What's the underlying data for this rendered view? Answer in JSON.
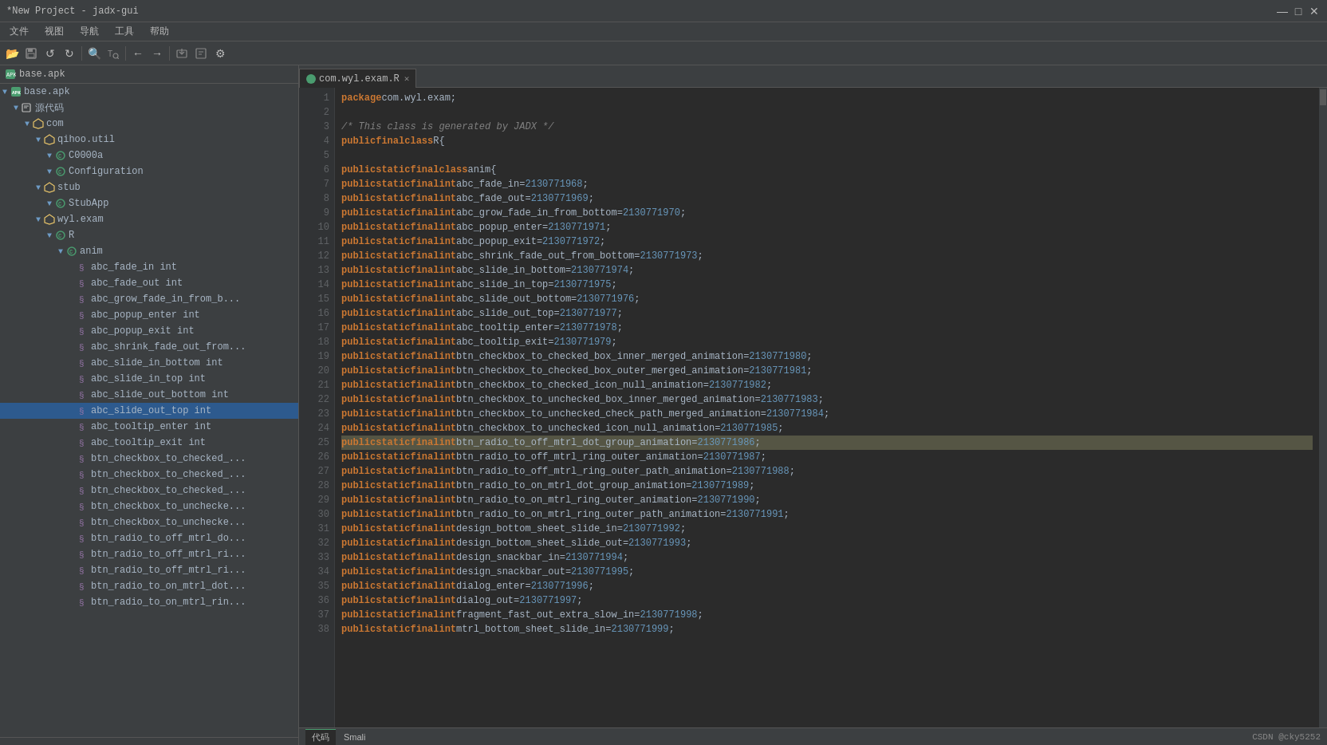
{
  "window": {
    "title": "*New Project - jadx-gui",
    "controls": [
      "—",
      "□",
      "✕"
    ]
  },
  "menu": {
    "items": [
      "文件",
      "视图",
      "导航",
      "工具",
      "帮助"
    ]
  },
  "toolbar": {
    "buttons": [
      "📂",
      "💾",
      "↺",
      "↻",
      "🔍",
      "⚙"
    ]
  },
  "sidebar": {
    "header": "base.apk",
    "tree": [
      {
        "id": 1,
        "indent": 0,
        "arrow": "▼",
        "icon": "📦",
        "label": "base.apk",
        "iconClass": "icon-apk",
        "type": "apk"
      },
      {
        "id": 2,
        "indent": 1,
        "arrow": "▼",
        "icon": "📂",
        "label": "源代码",
        "iconClass": "icon-src",
        "type": "src"
      },
      {
        "id": 3,
        "indent": 2,
        "arrow": "▼",
        "icon": "📦",
        "label": "com",
        "iconClass": "icon-pkg",
        "type": "pkg"
      },
      {
        "id": 4,
        "indent": 3,
        "arrow": "▼",
        "icon": "📦",
        "label": "qihoo.util",
        "iconClass": "icon-pkg",
        "type": "pkg"
      },
      {
        "id": 5,
        "indent": 4,
        "arrow": "▼",
        "icon": "C",
        "label": "C0000a",
        "iconClass": "icon-class",
        "type": "class"
      },
      {
        "id": 6,
        "indent": 4,
        "arrow": "▼",
        "icon": "C",
        "label": "Configuration",
        "iconClass": "icon-class",
        "type": "class"
      },
      {
        "id": 7,
        "indent": 3,
        "arrow": "▼",
        "icon": "📦",
        "label": "stub",
        "iconClass": "icon-pkg",
        "type": "pkg"
      },
      {
        "id": 8,
        "indent": 4,
        "arrow": "▼",
        "icon": "C",
        "label": "StubApp",
        "iconClass": "icon-class",
        "type": "class"
      },
      {
        "id": 9,
        "indent": 3,
        "arrow": "▼",
        "icon": "📦",
        "label": "wyl.exam",
        "iconClass": "icon-pkg",
        "type": "pkg"
      },
      {
        "id": 10,
        "indent": 4,
        "arrow": "▼",
        "icon": "C",
        "label": "R",
        "iconClass": "icon-class",
        "type": "class"
      },
      {
        "id": 11,
        "indent": 5,
        "arrow": "▼",
        "icon": "C",
        "label": "anim",
        "iconClass": "icon-class",
        "type": "class"
      },
      {
        "id": 12,
        "indent": 6,
        "arrow": "",
        "icon": "§",
        "label": "abc_fade_in int",
        "iconClass": "icon-field",
        "type": "field"
      },
      {
        "id": 13,
        "indent": 6,
        "arrow": "",
        "icon": "§",
        "label": "abc_fade_out int",
        "iconClass": "icon-field",
        "type": "field"
      },
      {
        "id": 14,
        "indent": 6,
        "arrow": "",
        "icon": "§",
        "label": "abc_grow_fade_in_from_b...",
        "iconClass": "icon-field",
        "type": "field"
      },
      {
        "id": 15,
        "indent": 6,
        "arrow": "",
        "icon": "§",
        "label": "abc_popup_enter int",
        "iconClass": "icon-field",
        "type": "field"
      },
      {
        "id": 16,
        "indent": 6,
        "arrow": "",
        "icon": "§",
        "label": "abc_popup_exit int",
        "iconClass": "icon-field",
        "type": "field"
      },
      {
        "id": 17,
        "indent": 6,
        "arrow": "",
        "icon": "§",
        "label": "abc_shrink_fade_out_from...",
        "iconClass": "icon-field",
        "type": "field"
      },
      {
        "id": 18,
        "indent": 6,
        "arrow": "",
        "icon": "§",
        "label": "abc_slide_in_bottom int",
        "iconClass": "icon-field",
        "type": "field"
      },
      {
        "id": 19,
        "indent": 6,
        "arrow": "",
        "icon": "§",
        "label": "abc_slide_in_top int",
        "iconClass": "icon-field",
        "type": "field"
      },
      {
        "id": 20,
        "indent": 6,
        "arrow": "",
        "icon": "§",
        "label": "abc_slide_out_bottom int",
        "iconClass": "icon-field",
        "type": "field"
      },
      {
        "id": 21,
        "indent": 6,
        "arrow": "",
        "icon": "§",
        "label": "abc_slide_out_top int",
        "iconClass": "icon-field",
        "type": "field",
        "selected": true
      },
      {
        "id": 22,
        "indent": 6,
        "arrow": "",
        "icon": "§",
        "label": "abc_tooltip_enter int",
        "iconClass": "icon-field",
        "type": "field"
      },
      {
        "id": 23,
        "indent": 6,
        "arrow": "",
        "icon": "§",
        "label": "abc_tooltip_exit int",
        "iconClass": "icon-field",
        "type": "field"
      },
      {
        "id": 24,
        "indent": 6,
        "arrow": "",
        "icon": "§",
        "label": "btn_checkbox_to_checked_...",
        "iconClass": "icon-field",
        "type": "field"
      },
      {
        "id": 25,
        "indent": 6,
        "arrow": "",
        "icon": "§",
        "label": "btn_checkbox_to_checked_...",
        "iconClass": "icon-field",
        "type": "field"
      },
      {
        "id": 26,
        "indent": 6,
        "arrow": "",
        "icon": "§",
        "label": "btn_checkbox_to_checked_...",
        "iconClass": "icon-field",
        "type": "field"
      },
      {
        "id": 27,
        "indent": 6,
        "arrow": "",
        "icon": "§",
        "label": "btn_checkbox_to_unchecke...",
        "iconClass": "icon-field",
        "type": "field"
      },
      {
        "id": 28,
        "indent": 6,
        "arrow": "",
        "icon": "§",
        "label": "btn_checkbox_to_unchecke...",
        "iconClass": "icon-field",
        "type": "field"
      },
      {
        "id": 29,
        "indent": 6,
        "arrow": "",
        "icon": "§",
        "label": "btn_radio_to_off_mtrl_do...",
        "iconClass": "icon-field",
        "type": "field"
      },
      {
        "id": 30,
        "indent": 6,
        "arrow": "",
        "icon": "§",
        "label": "btn_radio_to_off_mtrl_ri...",
        "iconClass": "icon-field",
        "type": "field"
      },
      {
        "id": 31,
        "indent": 6,
        "arrow": "",
        "icon": "§",
        "label": "btn_radio_to_off_mtrl_ri...",
        "iconClass": "icon-field",
        "type": "field"
      },
      {
        "id": 32,
        "indent": 6,
        "arrow": "",
        "icon": "§",
        "label": "btn_radio_to_on_mtrl_dot...",
        "iconClass": "icon-field",
        "type": "field"
      },
      {
        "id": 33,
        "indent": 6,
        "arrow": "",
        "icon": "§",
        "label": "btn_radio_to_on_mtrl_rin...",
        "iconClass": "icon-field",
        "type": "field"
      }
    ]
  },
  "editor": {
    "tab": {
      "label": "com.wyl.exam.R",
      "close": "✕"
    },
    "lines": [
      {
        "num": 1,
        "content": "package com.wyl.exam;",
        "tokens": [
          {
            "t": "kw",
            "v": "package"
          },
          {
            "t": "pkg-color",
            "v": " com.wyl.exam"
          },
          {
            "t": "var",
            "v": ";"
          }
        ]
      },
      {
        "num": 2,
        "content": ""
      },
      {
        "num": 3,
        "content": "/* This class is generated by JADX */",
        "tokens": [
          {
            "t": "cmt",
            "v": "/* This class is generated by JADX */"
          }
        ]
      },
      {
        "num": 4,
        "content": "public final class R {",
        "tokens": [
          {
            "t": "kw",
            "v": "public"
          },
          {
            "t": "kw",
            "v": " final"
          },
          {
            "t": "kw",
            "v": " class"
          },
          {
            "t": "cls",
            "v": " R"
          },
          {
            "t": "var",
            "v": " {"
          }
        ]
      },
      {
        "num": 5,
        "content": ""
      },
      {
        "num": 6,
        "content": "    public static final class anim {",
        "tokens": [
          {
            "t": "ws",
            "v": "    "
          },
          {
            "t": "kw",
            "v": "public"
          },
          {
            "t": "kw",
            "v": " static"
          },
          {
            "t": "kw",
            "v": " final"
          },
          {
            "t": "kw",
            "v": " class"
          },
          {
            "t": "fn",
            "v": " anim"
          },
          {
            "t": "var",
            "v": " {"
          }
        ]
      },
      {
        "num": 7,
        "content": "        public static final int abc_fade_in = 2130771968;"
      },
      {
        "num": 8,
        "content": "        public static final int abc_fade_out = 2130771969;"
      },
      {
        "num": 9,
        "content": "        public static final int abc_grow_fade_in_from_bottom = 2130771970;"
      },
      {
        "num": 10,
        "content": "        public static final int abc_popup_enter = 2130771971;"
      },
      {
        "num": 11,
        "content": "        public static final int abc_popup_exit = 2130771972;"
      },
      {
        "num": 12,
        "content": "        public static final int abc_shrink_fade_out_from_bottom = 2130771973;"
      },
      {
        "num": 13,
        "content": "        public static final int abc_slide_in_bottom = 2130771974;"
      },
      {
        "num": 14,
        "content": "        public static final int abc_slide_in_top = 2130771975;"
      },
      {
        "num": 15,
        "content": "        public static final int abc_slide_out_bottom = 2130771976;"
      },
      {
        "num": 16,
        "content": "        public static final int abc_slide_out_top = 2130771977;"
      },
      {
        "num": 17,
        "content": "        public static final int abc_tooltip_enter = 2130771978;"
      },
      {
        "num": 18,
        "content": "        public static final int abc_tooltip_exit = 2130771979;"
      },
      {
        "num": 19,
        "content": "        public static final int btn_checkbox_to_checked_box_inner_merged_animation = 2130771980;"
      },
      {
        "num": 20,
        "content": "        public static final int btn_checkbox_to_checked_box_outer_merged_animation = 2130771981;"
      },
      {
        "num": 21,
        "content": "        public static final int btn_checkbox_to_checked_icon_null_animation = 2130771982;"
      },
      {
        "num": 22,
        "content": "        public static final int btn_checkbox_to_unchecked_box_inner_merged_animation = 2130771983;"
      },
      {
        "num": 23,
        "content": "        public static final int btn_checkbox_to_unchecked_check_path_merged_animation = 2130771984;"
      },
      {
        "num": 24,
        "content": "        public static final int btn_checkbox_to_unchecked_icon_null_animation = 2130771985;"
      },
      {
        "num": 25,
        "content": "        public static final int btn_radio_to_off_mtrl_dot_group_animation = 2130771986;",
        "highlighted": true
      },
      {
        "num": 26,
        "content": "        public static final int btn_radio_to_off_mtrl_ring_outer_animation = 2130771987;"
      },
      {
        "num": 27,
        "content": "        public static final int btn_radio_to_off_mtrl_ring_outer_path_animation = 2130771988;"
      },
      {
        "num": 28,
        "content": "        public static final int btn_radio_to_on_mtrl_dot_group_animation = 2130771989;"
      },
      {
        "num": 29,
        "content": "        public static final int btn_radio_to_on_mtrl_ring_outer_animation = 2130771990;"
      },
      {
        "num": 30,
        "content": "        public static final int btn_radio_to_on_mtrl_ring_outer_path_animation = 2130771991;"
      },
      {
        "num": 31,
        "content": "        public static final int design_bottom_sheet_slide_in = 2130771992;"
      },
      {
        "num": 32,
        "content": "        public static final int design_bottom_sheet_slide_out = 2130771993;"
      },
      {
        "num": 33,
        "content": "        public static final int design_snackbar_in = 2130771994;"
      },
      {
        "num": 34,
        "content": "        public static final int design_snackbar_out = 2130771995;"
      },
      {
        "num": 35,
        "content": "        public static final int dialog_enter = 2130771996;"
      },
      {
        "num": 36,
        "content": "        public static final int dialog_out = 2130771997;"
      },
      {
        "num": 37,
        "content": "        public static final int fragment_fast_out_extra_slow_in = 2130771998;"
      },
      {
        "num": 38,
        "content": "        public static final int mtrl_bottom_sheet_slide_in = 2130771999;"
      }
    ]
  },
  "bottom": {
    "tabs": [
      {
        "label": "代码",
        "active": true
      },
      {
        "label": "Smali",
        "active": false
      }
    ],
    "status": "CSDN @cky5252"
  }
}
